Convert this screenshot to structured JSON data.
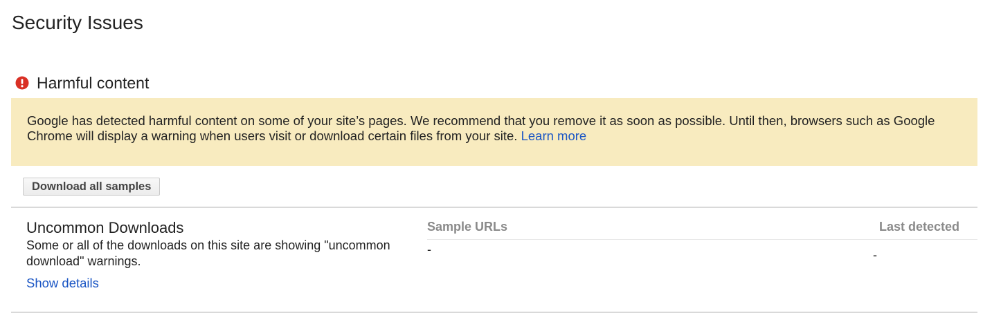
{
  "page": {
    "title": "Security Issues"
  },
  "section": {
    "title": "Harmful content",
    "icon": "alert-circle-icon",
    "icon_color": "#d93025"
  },
  "banner": {
    "text": "Google has detected harmful content on some of your site’s pages. We recommend that you remove it as soon as possible. Until then, browsers such as Google Chrome will display a warning when users visit or download certain files from your site.",
    "link_label": "Learn more",
    "background_color": "#f8ebbf",
    "link_color": "#1a55c4"
  },
  "actions": {
    "download_all_label": "Download all samples"
  },
  "table": {
    "columns": {
      "sample_urls": "Sample URLs",
      "last_detected": "Last detected"
    },
    "rows": [
      {
        "issue_name": "Uncommon Downloads",
        "description": "Some or all of the downloads on this site are showing \"uncommon download\" warnings.",
        "details_link": "Show details",
        "sample_url": "-",
        "last_detected": "-"
      }
    ]
  }
}
